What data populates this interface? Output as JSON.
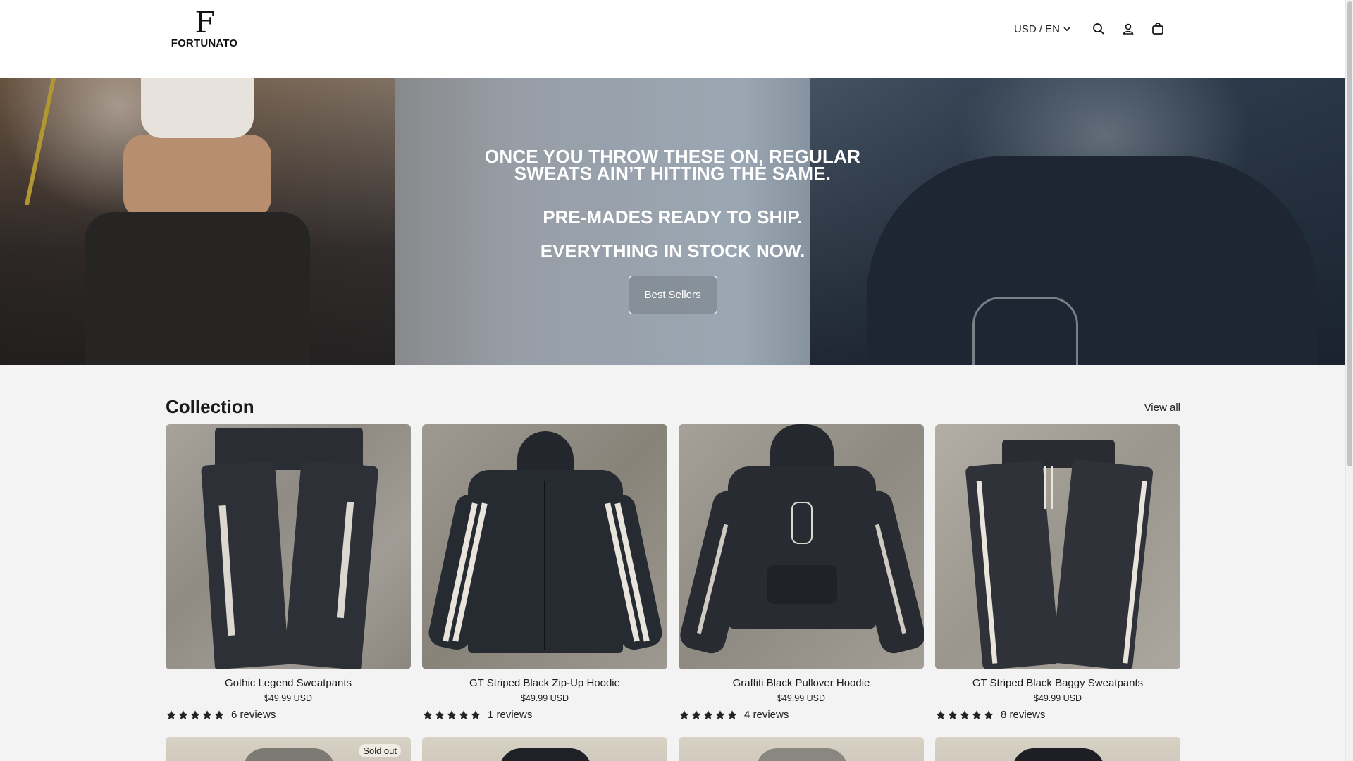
{
  "header": {
    "logo_mark": "F",
    "logo_text": "FORTUNATO",
    "locale": "USD / EN",
    "icons": [
      "search-icon",
      "account-icon",
      "cart-icon"
    ]
  },
  "hero": {
    "headline": "ONCE YOU THROW THESE ON, REGULAR SWEATS AIN’T HITTING THE SAME.",
    "line2": "PRE-MADES READY TO SHIP.",
    "line3": "EVERYTHING IN STOCK NOW.",
    "button": "Best Sellers"
  },
  "collection": {
    "title": "Collection",
    "view_all": "View all",
    "products": [
      {
        "name": "Gothic Legend Sweatpants",
        "price": "$49.99 USD",
        "reviews": "6 reviews",
        "stars": 5
      },
      {
        "name": "GT Striped Black Zip-Up Hoodie",
        "price": "$49.99 USD",
        "reviews": "1 reviews",
        "stars": 5
      },
      {
        "name": "Graffiti Black Pullover Hoodie",
        "price": "$49.99 USD",
        "reviews": "4 reviews",
        "stars": 5
      },
      {
        "name": "GT Striped Black Baggy Sweatpants",
        "price": "$49.99 USD",
        "reviews": "8 reviews",
        "stars": 5
      }
    ],
    "row2": [
      {
        "badge": "Sold out"
      },
      {
        "badge": ""
      },
      {
        "badge": ""
      },
      {
        "badge": ""
      }
    ]
  },
  "colors": {
    "accent": "#121212",
    "background": "#ffffff",
    "section_bg": "#f3f3f3"
  }
}
